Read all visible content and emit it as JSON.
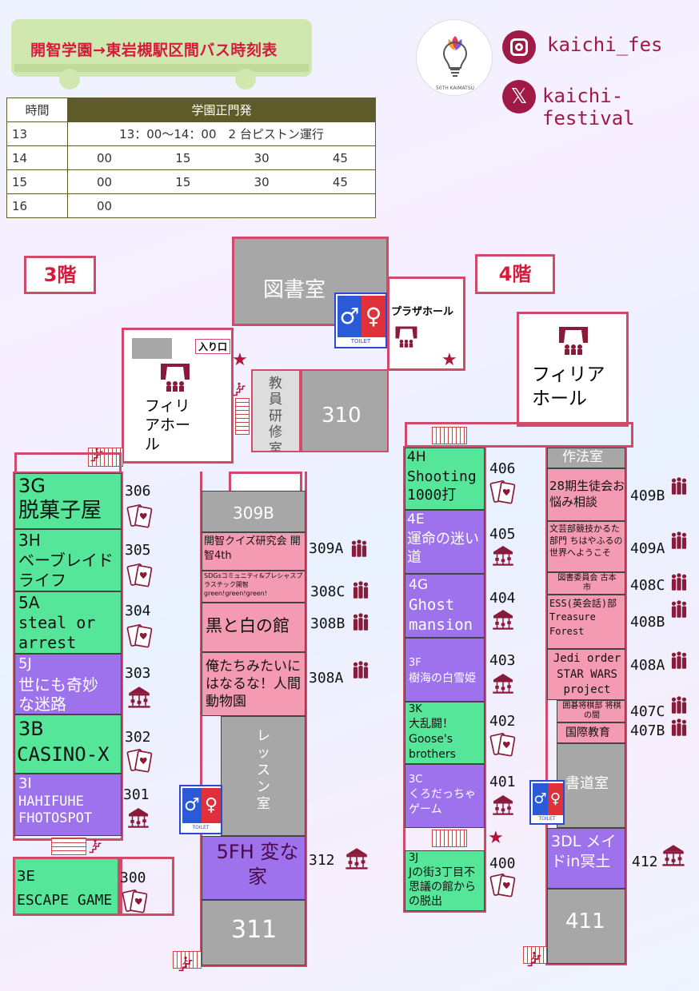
{
  "header": {
    "bus_title": "開智学園→東岩槻駅区間バス時刻表"
  },
  "bus_table": {
    "col_time": "時間",
    "col_origin": "学園正門発",
    "rows": [
      {
        "hour": "13",
        "note": "13：00～14：00　2 台ピストン運行"
      },
      {
        "hour": "14",
        "times": [
          "00",
          "15",
          "30",
          "45"
        ]
      },
      {
        "hour": "15",
        "times": [
          "00",
          "15",
          "30",
          "45"
        ]
      },
      {
        "hour": "16",
        "times": [
          "00"
        ]
      }
    ]
  },
  "social": {
    "instagram": "kaichi_fes",
    "x": "kaichi-festival",
    "logo_text": "50TH KAIMATSU"
  },
  "floor3": {
    "label": "3階",
    "library": "図書室",
    "plaza_hall": "プラザホール",
    "philia_hall": "フィリアホール",
    "entrance": "入り口",
    "teacher_room": "教員研修室",
    "room_310": "310",
    "room_309b": "309B",
    "room_311": "311",
    "lesson_room": "レッスン室",
    "toilet": "TOILET",
    "rooms": [
      {
        "num": "306",
        "title": "3G",
        "name": "脱菓子屋"
      },
      {
        "num": "305",
        "title": "3H",
        "name": "ベーブレイドライフ"
      },
      {
        "num": "304",
        "title": "5A",
        "name": "steal or arrest"
      },
      {
        "num": "303",
        "title": "5J",
        "name": "世にも奇妙な迷路"
      },
      {
        "num": "302",
        "title": "3B",
        "name": "CASINO-X"
      },
      {
        "num": "301",
        "title": "3I",
        "name": "HAHIFUHE FHOTOSPOT"
      },
      {
        "num": "300",
        "title": "3E",
        "name": "ESCAPE GAME"
      }
    ],
    "mid_rooms": [
      {
        "num": "309A",
        "name": "開智クイズ研究会 開智4th"
      },
      {
        "num": "308C",
        "name": "SDGsコミュニティ&プレシャスプラスチック開智 green!green!green!"
      },
      {
        "num": "308B",
        "name": "黒と白の館"
      },
      {
        "num": "308A",
        "name": "俺たちみたいにはなるな！人間動物園"
      },
      {
        "num": "312",
        "name": "5FH 変な家"
      }
    ]
  },
  "floor4": {
    "label": "4階",
    "philia_hall": "フィリアホール",
    "sahou": "作法室",
    "shodou": "書道室",
    "room_411": "411",
    "toilet": "TOILET",
    "left_rooms": [
      {
        "num": "406",
        "title": "4H",
        "name": "Shooting 1000打"
      },
      {
        "num": "405",
        "title": "4E",
        "name": "運命の迷い道"
      },
      {
        "num": "404",
        "title": "4G",
        "name": "Ghost mansion"
      },
      {
        "num": "403",
        "title": "3F",
        "name": "樹海の白雪姫"
      },
      {
        "num": "402",
        "title": "3K",
        "name": "大乱闘！Goose's brothers"
      },
      {
        "num": "401",
        "title": "3C",
        "name": "くろだっちゃゲーム"
      },
      {
        "num": "400",
        "title": "3J",
        "name": "Jの街3丁目不思議の館からの脱出"
      }
    ],
    "right_rooms": [
      {
        "num": "409B",
        "name": "28期生徒会お悩み相談"
      },
      {
        "num": "409A",
        "name": "文芸部競技かるた部門 ちはやふるの世界へようこそ"
      },
      {
        "num": "408C",
        "name": "図書委員会 古本市"
      },
      {
        "num": "408B",
        "name": "ESS(英会話)部 Treasure Forest"
      },
      {
        "num": "408A",
        "name": "Jedi order STAR WARS project"
      },
      {
        "num": "407C",
        "name": "囲碁将棋部 将棋の間"
      },
      {
        "num": "407B",
        "name": "国際教育"
      },
      {
        "num": "412",
        "name": "3DL メイドin冥土"
      }
    ]
  }
}
